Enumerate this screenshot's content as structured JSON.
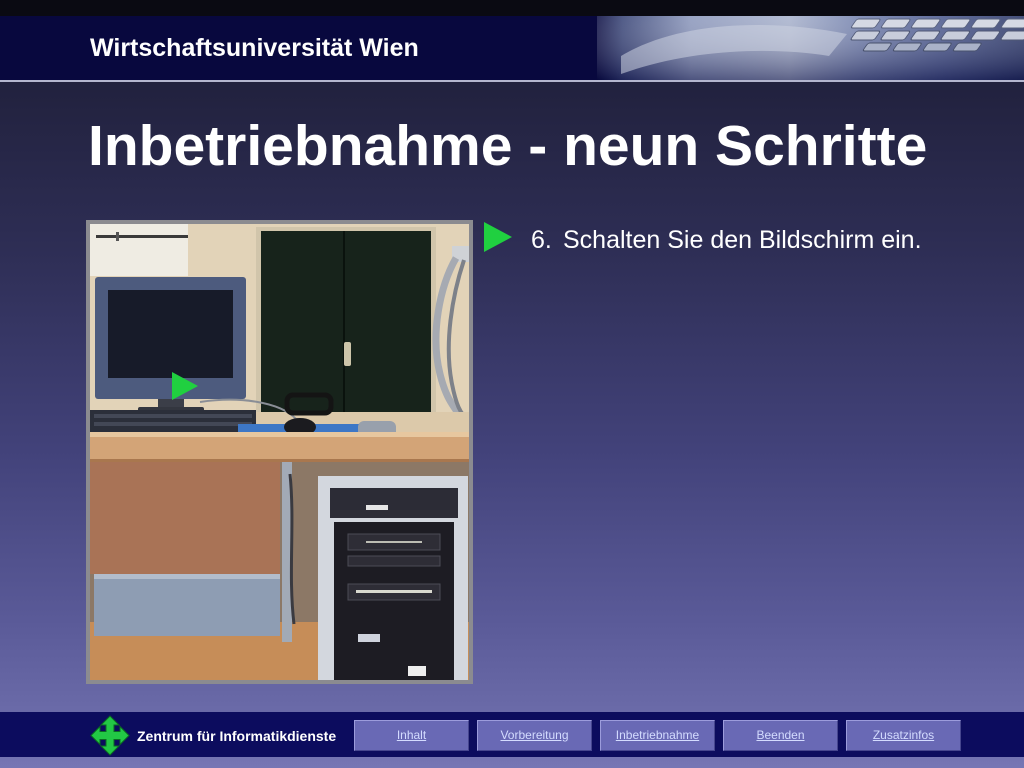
{
  "header": {
    "institution": "Wirtschaftsuniversität Wien"
  },
  "slide": {
    "title": "Inbetriebnahme - neun Schritte",
    "step": {
      "number": "6.",
      "text": "Schalten Sie den Bildschirm ein."
    }
  },
  "footer": {
    "organization": "Zentrum für Informatikdienste",
    "nav": [
      {
        "label": "Inhalt"
      },
      {
        "label": "Vorbereitung"
      },
      {
        "label": "Inbetriebnahme"
      },
      {
        "label": "Beenden"
      },
      {
        "label": "Zusatzinfos"
      }
    ]
  },
  "icons": {
    "step_bullet": "play-arrow-icon",
    "photo_marker": "play-arrow-icon",
    "footer_logo": "four-way-arrows-icon"
  },
  "colors": {
    "accent_green": "#20d040",
    "header_navy": "#08083e",
    "nav_bar": "#0c0c5e",
    "nav_button": "#6969b5",
    "nav_link": "#d4dcff",
    "text": "#ffffff"
  }
}
